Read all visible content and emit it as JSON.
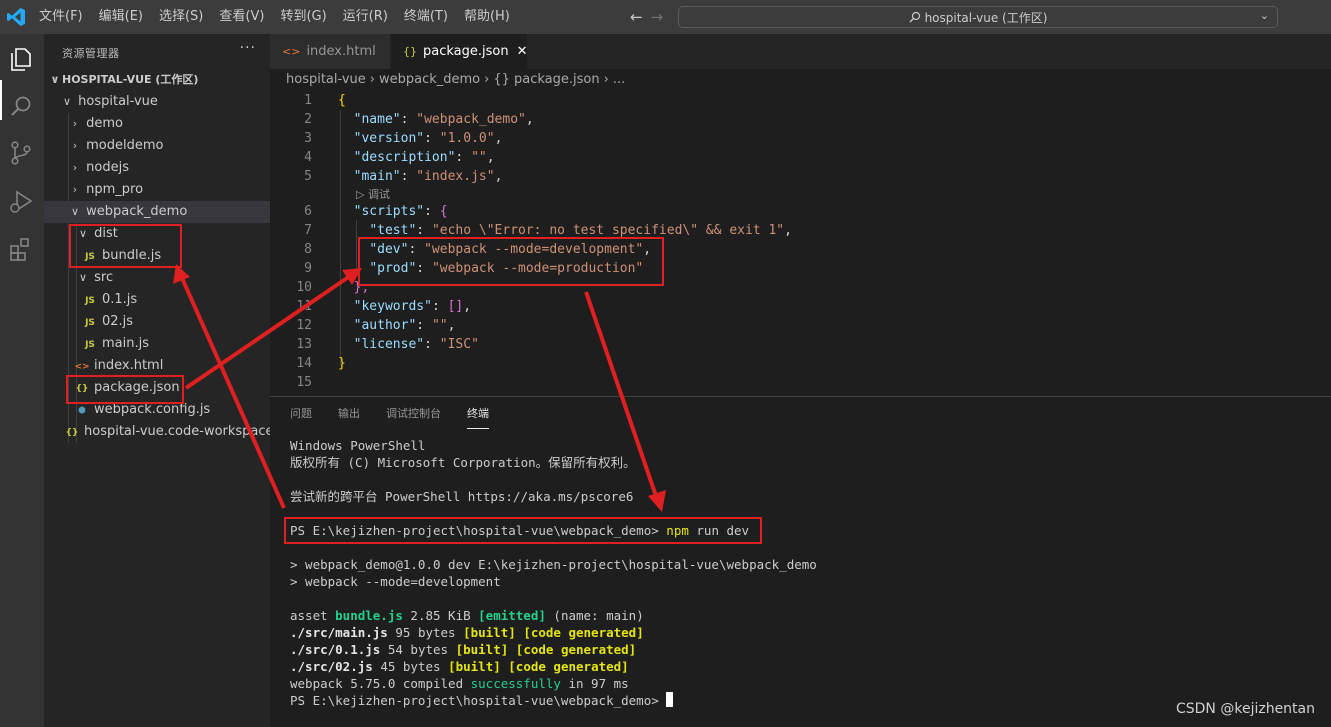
{
  "window": {
    "menu": [
      "文件(F)",
      "编辑(E)",
      "选择(S)",
      "查看(V)",
      "转到(G)",
      "运行(R)",
      "终端(T)",
      "帮助(H)"
    ],
    "search": "hospital-vue (工作区)",
    "accent": "#0e639c"
  },
  "sidebar": {
    "title": "资源管理器",
    "more": "···",
    "workspace": "HOSPITAL-VUE (工作区)",
    "tree": [
      {
        "label": "hospital-vue",
        "chev": "∨",
        "icon": ""
      },
      {
        "label": "demo",
        "chev": "›",
        "icon": ""
      },
      {
        "label": "modeldemo",
        "chev": "›",
        "icon": ""
      },
      {
        "label": "nodejs",
        "chev": "›",
        "icon": ""
      },
      {
        "label": "npm_pro",
        "chev": "›",
        "icon": ""
      },
      {
        "label": "webpack_demo",
        "chev": "∨",
        "icon": ""
      },
      {
        "label": "dist",
        "chev": "∨",
        "icon": ""
      },
      {
        "label": "bundle.js",
        "chev": "",
        "icon": "JS"
      },
      {
        "label": "src",
        "chev": "∨",
        "icon": ""
      },
      {
        "label": "0.1.js",
        "chev": "",
        "icon": "JS"
      },
      {
        "label": "02.js",
        "chev": "",
        "icon": "JS"
      },
      {
        "label": "main.js",
        "chev": "",
        "icon": "JS"
      },
      {
        "label": "index.html",
        "chev": "",
        "icon": "<>"
      },
      {
        "label": "package.json",
        "chev": "",
        "icon": "{}"
      },
      {
        "label": "webpack.config.js",
        "chev": "",
        "icon": "⬢"
      },
      {
        "label": "hospital-vue.code-workspace",
        "chev": "",
        "icon": "{}"
      }
    ]
  },
  "tabs": [
    {
      "label": "index.html",
      "icon": "<>"
    },
    {
      "label": "package.json",
      "icon": "{}",
      "close": "✕"
    }
  ],
  "breadcrumb": [
    "hospital-vue",
    "webpack_demo",
    "{} package.json",
    "..."
  ],
  "editor": {
    "line_numbers": [
      "1",
      "2",
      "3",
      "4",
      "5",
      "6",
      "7",
      "8",
      "9",
      "10",
      "11",
      "12",
      "13",
      "14",
      "15"
    ],
    "codelens": "▷ 调试",
    "lines": {
      "l1": "{",
      "l2k": "\"name\"",
      "l2v": "\"webpack_demo\"",
      "l3k": "\"version\"",
      "l3v": "\"1.0.0\"",
      "l4k": "\"description\"",
      "l4v": "\"\"",
      "l5k": "\"main\"",
      "l5v": "\"index.js\"",
      "l6k": "\"scripts\"",
      "l6b": "{",
      "l7k": "\"test\"",
      "l7v": "\"echo \\\"Error: no test specified\\\" && exit 1\"",
      "l8k": "\"dev\"",
      "l8v": "\"webpack --mode=development\"",
      "l9k": "\"prod\"",
      "l9v": "\"webpack --mode=production\"",
      "l10": "},",
      "l11k": "\"keywords\"",
      "l11v": "[]",
      "l12k": "\"author\"",
      "l12v": "\"\"",
      "l13k": "\"license\"",
      "l13v": "\"ISC\"",
      "l14": "}"
    }
  },
  "panel": {
    "tabs": [
      "问题",
      "输出",
      "调试控制台",
      "终端"
    ],
    "active_tab": "终端",
    "terminal": {
      "t1": "Windows PowerShell",
      "t2": "版权所有 (C) Microsoft Corporation。保留所有权利。",
      "t3": "尝试新的跨平台 PowerShell https://aka.ms/pscore6",
      "prompt": "PS E:\\kejizhen-project\\hospital-vue\\webpack_demo> ",
      "cmd_npm": "npm",
      "cmd_rest": " run dev",
      "o1": "> webpack_demo@1.0.0 dev E:\\kejizhen-project\\hospital-vue\\webpack_demo",
      "o2": "> webpack --mode=development",
      "a_asset": "asset ",
      "a_file": "bundle.js",
      "a_size": " 2.85 KiB ",
      "a_emitted": "[emitted]",
      "a_name": " (name: main)",
      "m1_path": "./src/main.js",
      "m1_bytes": " 95 bytes ",
      "m2_path": "./src/0.1.js",
      "m2_bytes": " 54 bytes ",
      "m3_path": "./src/02.js",
      "m3_bytes": " 45 bytes ",
      "built": "[built]",
      "code_generated": "[code generated]",
      "c_pre": "webpack 5.75.0 compiled ",
      "c_ok": "successfully",
      "c_post": " in 97 ms",
      "final_prompt": "PS E:\\kejizhen-project\\hospital-vue\\webpack_demo> "
    }
  },
  "watermark": "CSDN @kejizhentan",
  "annotation_color": "#e02020"
}
